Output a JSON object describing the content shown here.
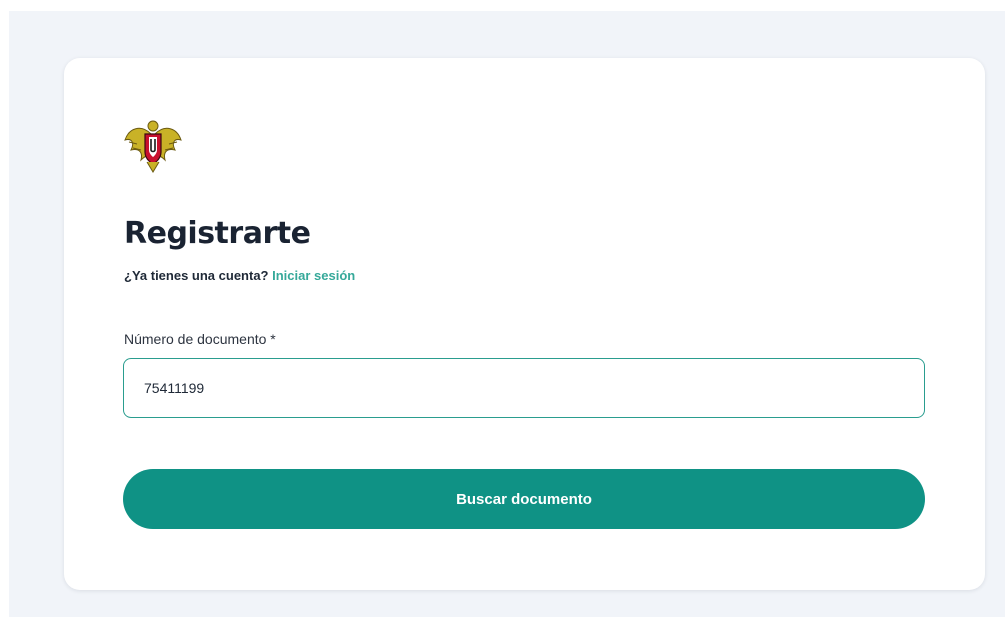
{
  "logo": {
    "icon": "university-crest-icon"
  },
  "form": {
    "title": "Registrarte",
    "subtitle_prefix": "¿Ya tienes una cuenta? ",
    "login_link": "Iniciar sesión",
    "document_label": "Número de documento *",
    "document_value": "75411199",
    "submit_label": "Buscar documento"
  },
  "colors": {
    "accent": "#0f9285",
    "link": "#36a99a",
    "background": "#f1f4f9",
    "title": "#1a2332"
  }
}
